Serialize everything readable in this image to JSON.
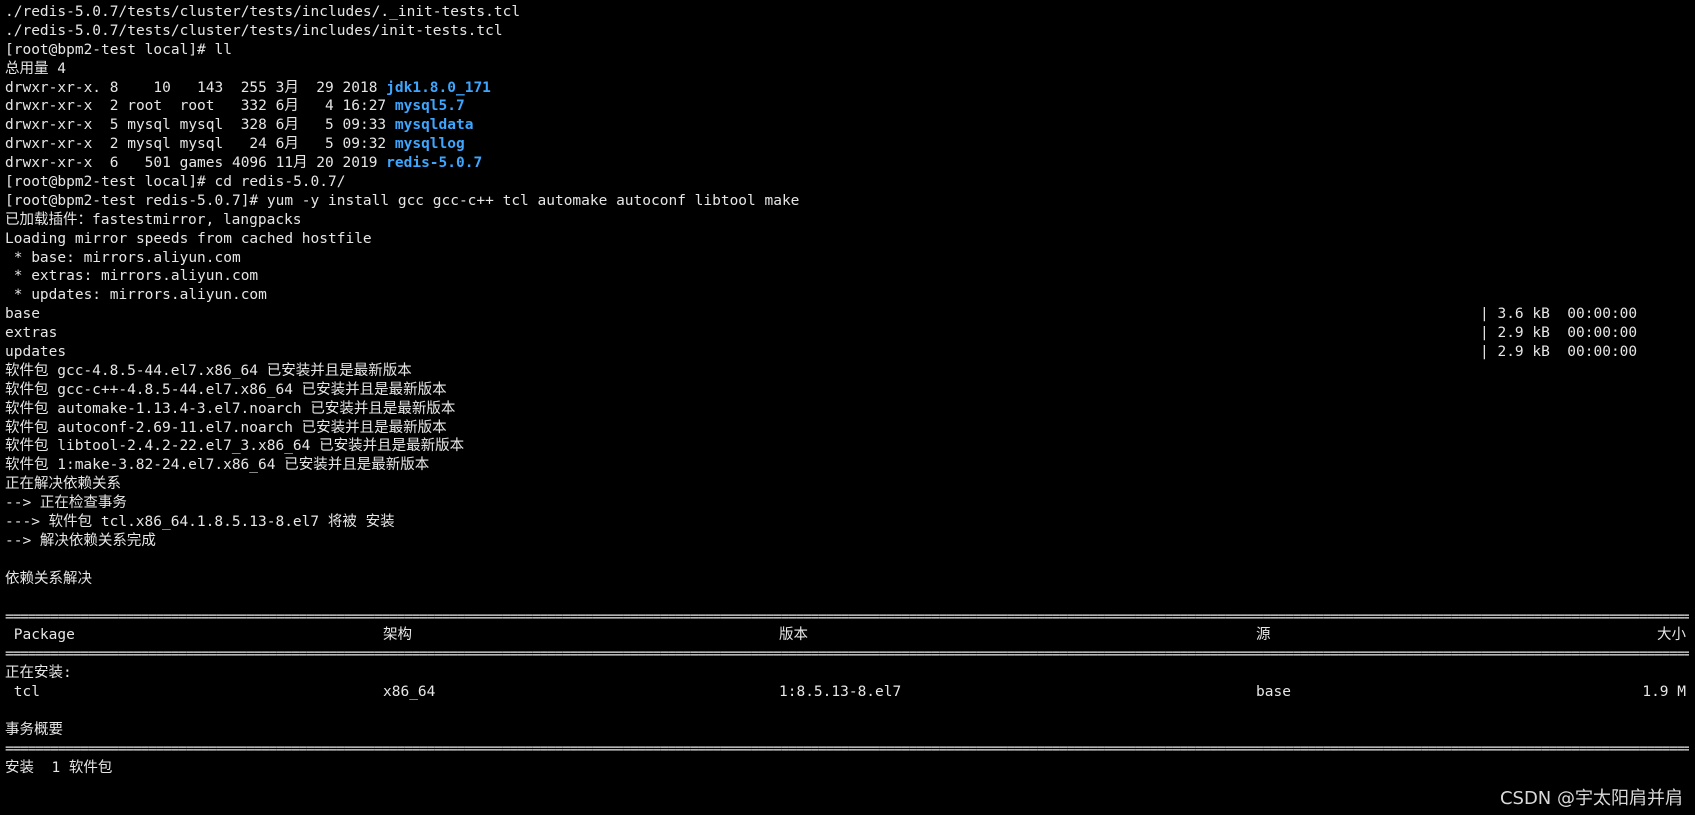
{
  "lines_top": [
    "./redis-5.0.7/tests/cluster/tests/includes/._init-tests.tcl",
    "./redis-5.0.7/tests/cluster/tests/includes/init-tests.tcl",
    "[root@bpm2-test local]# ll",
    "总用量 4"
  ],
  "listing": [
    {
      "prefix": "drwxr-xr-x. 8    10   143  255 3月  29 2018 ",
      "name": "jdk1.8.0_171"
    },
    {
      "prefix": "drwxr-xr-x  2 root  root   332 6月   4 16:27 ",
      "name": "mysql5.7"
    },
    {
      "prefix": "drwxr-xr-x  5 mysql mysql  328 6月   5 09:33 ",
      "name": "mysqldata"
    },
    {
      "prefix": "drwxr-xr-x  2 mysql mysql   24 6月   5 09:32 ",
      "name": "mysqllog"
    },
    {
      "prefix": "drwxr-xr-x  6   501 games 4096 11月 20 2019 ",
      "name": "redis-5.0.7"
    }
  ],
  "lines_mid": [
    "[root@bpm2-test local]# cd redis-5.0.7/",
    "[root@bpm2-test redis-5.0.7]# yum -y install gcc gcc-c++ tcl automake autoconf libtool make",
    "已加载插件：fastestmirror, langpacks",
    "Loading mirror speeds from cached hostfile",
    " * base: mirrors.aliyun.com",
    " * extras: mirrors.aliyun.com",
    " * updates: mirrors.aliyun.com"
  ],
  "repos": [
    {
      "name": "base",
      "info": "| 3.6 kB  00:00:00"
    },
    {
      "name": "extras",
      "info": "| 2.9 kB  00:00:00"
    },
    {
      "name": "updates",
      "info": "| 2.9 kB  00:00:00"
    }
  ],
  "lines_packages": [
    "软件包 gcc-4.8.5-44.el7.x86_64 已安装并且是最新版本",
    "软件包 gcc-c++-4.8.5-44.el7.x86_64 已安装并且是最新版本",
    "软件包 automake-1.13.4-3.el7.noarch 已安装并且是最新版本",
    "软件包 autoconf-2.69-11.el7.noarch 已安装并且是最新版本",
    "软件包 libtool-2.4.2-22.el7_3.x86_64 已安装并且是最新版本",
    "软件包 1:make-3.82-24.el7.x86_64 已安装并且是最新版本",
    "正在解决依赖关系",
    "--> 正在检查事务",
    "---> 软件包 tcl.x86_64.1.8.5.13-8.el7 将被 安装",
    "--> 解决依赖关系完成",
    "",
    "依赖关系解决",
    ""
  ],
  "separator": "==================================================================================================================================================================================================================================================",
  "table_header": {
    "package": " Package",
    "arch": "架构",
    "version": "版本",
    "repo": "源",
    "size": "大小"
  },
  "installing_label": "正在安装:",
  "table_row": {
    "package": " tcl",
    "arch": "x86_64",
    "version": "1:8.5.13-8.el7",
    "repo": "base",
    "size": "1.9 M"
  },
  "summary_label": "事务概要",
  "install_summary": "安装  1 软件包",
  "watermark": "CSDN @宇太阳肩并肩"
}
